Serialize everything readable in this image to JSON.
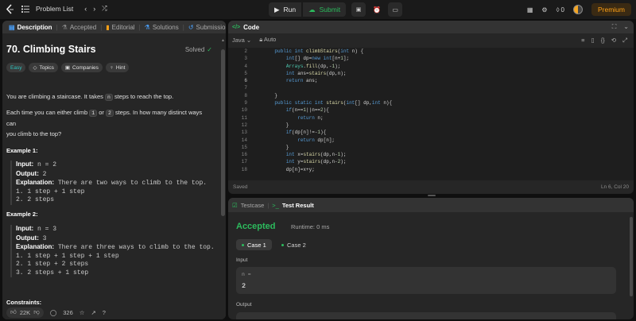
{
  "topbar": {
    "problem_list": "Problem List",
    "run": "Run",
    "submit": "Submit",
    "streak": "0",
    "premium": "Premium"
  },
  "left": {
    "tabs": [
      "Description",
      "Accepted",
      "Editorial",
      "Solutions",
      "Submissions"
    ],
    "title": "70. Climbing Stairs",
    "solved": "Solved",
    "tags": [
      "Easy",
      "Topics",
      "Companies",
      "Hint"
    ],
    "p1_a": "You are climbing a staircase. It takes ",
    "p1_kw": "n",
    "p1_b": " steps to reach the top.",
    "p2_a": "Each time you can either climb ",
    "p2_kw1": "1",
    "p2_mid": " or ",
    "p2_kw2": "2",
    "p2_b": " steps. In how many distinct ways can",
    "p2_c": "you climb to the top?",
    "ex1_title": "Example 1:",
    "ex1": {
      "input_label": "Input:",
      "input": " n = 2",
      "output_label": "Output:",
      "output": " 2",
      "expl_label": "Explanation:",
      "expl": " There are two ways to climb to the top.",
      "lines": [
        "1. 1 step + 1 step",
        "2. 2 steps"
      ]
    },
    "ex2_title": "Example 2:",
    "ex2": {
      "input_label": "Input:",
      "input": " n = 3",
      "output_label": "Output:",
      "output": " 3",
      "expl_label": "Explanation:",
      "expl": " There are three ways to climb to the top.",
      "lines": [
        "1. 1 step + 1 step + 1 step",
        "2. 1 step + 2 steps",
        "3. 2 steps + 1 step"
      ]
    },
    "constraints": "Constraints:",
    "likes": "22K",
    "comments": "326"
  },
  "code": {
    "title": "Code",
    "language": "Java",
    "mode": "Auto",
    "line_numbers": [
      "2",
      "3",
      "4",
      "5",
      "6",
      "7",
      "8",
      "9",
      "10",
      "11",
      "12",
      "13",
      "14",
      "15",
      "16",
      "17",
      "18"
    ],
    "lines": [
      "    public int climbStairs(int n) {",
      "        int[] dp=new int[n+1];",
      "        Arrays.fill(dp,-1);",
      "        int ans=stairs(dp,n);",
      "        return ans;",
      "",
      "    }",
      "    public static int stairs(int[] dp,int n){",
      "        if(n==1||n==2){",
      "            return n;",
      "        }",
      "        if(dp[n]!=-1){",
      "            return dp[n];",
      "        }",
      "        int x=stairs(dp,n-1);",
      "        int y=stairs(dp,n-2);",
      "        dp[n]=x+y;"
    ],
    "saved": "Saved",
    "cursor": "Ln 6, Col 20"
  },
  "result": {
    "testcase_tab": "Testcase",
    "result_tab": "Test Result",
    "status": "Accepted",
    "runtime": "Runtime: 0 ms",
    "cases": [
      "Case 1",
      "Case 2"
    ],
    "input_label": "Input",
    "var_name": "n =",
    "var_value": "2",
    "output_label": "Output"
  },
  "colors": {
    "accent_green": "#2cbb5d",
    "easy": "#2cc6c0",
    "premium": "#ffa116"
  }
}
